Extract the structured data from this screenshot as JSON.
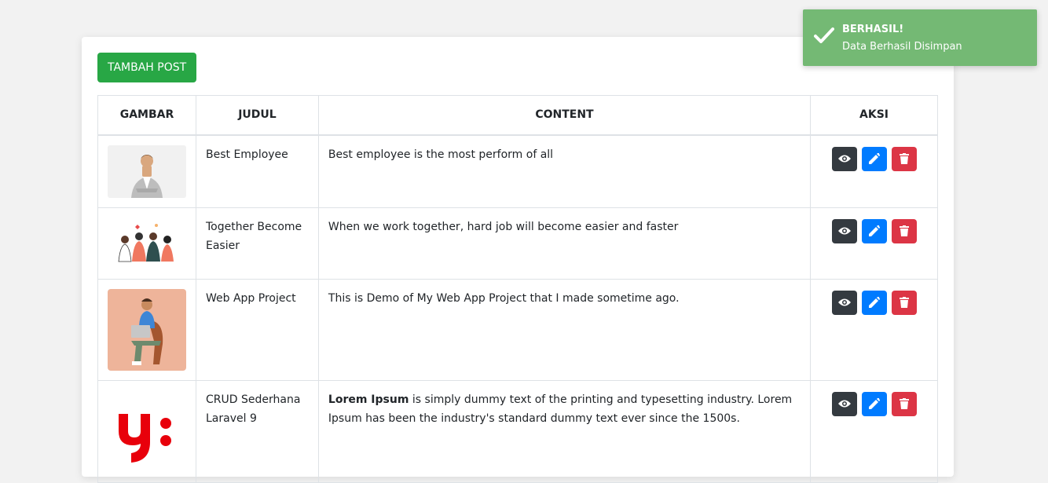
{
  "toolbar": {
    "add_label": "TAMBAH POST"
  },
  "table": {
    "headers": [
      "GAMBAR",
      "JUDUL",
      "CONTENT",
      "AKSI"
    ],
    "rows": [
      {
        "title_lines": [
          "Best Employee"
        ],
        "content_bold": "",
        "content": "Best employee is the most perform of all",
        "image": "person-in-suit-thumbnail"
      },
      {
        "title_lines": [
          "Together Become",
          "Easier"
        ],
        "content_bold": "",
        "content": "When we work together, hard job will become easier and faster",
        "image": "team-illustration-thumbnail"
      },
      {
        "title_lines": [
          "Web App Project"
        ],
        "content_bold": "",
        "content": "This is Demo of My Web App Project that I made sometime ago.",
        "image": "laptop-character-thumbnail"
      },
      {
        "title_lines": [
          "CRUD Sederhana",
          "Laravel 9"
        ],
        "content_bold": "Lorem Ipsum",
        "content": " is simply dummy text of the printing and typesetting industry. Lorem Ipsum has been the industry's standard dummy text ever since the 1500s.",
        "image": "red-logo-thumbnail"
      }
    ]
  },
  "toast": {
    "title": "BERHASIL!",
    "message": "Data Berhasil Disimpan"
  },
  "colors": {
    "success": "#28a745",
    "dark": "#343a40",
    "primary": "#007bff",
    "danger": "#dc3545",
    "toast": "#74b974"
  }
}
